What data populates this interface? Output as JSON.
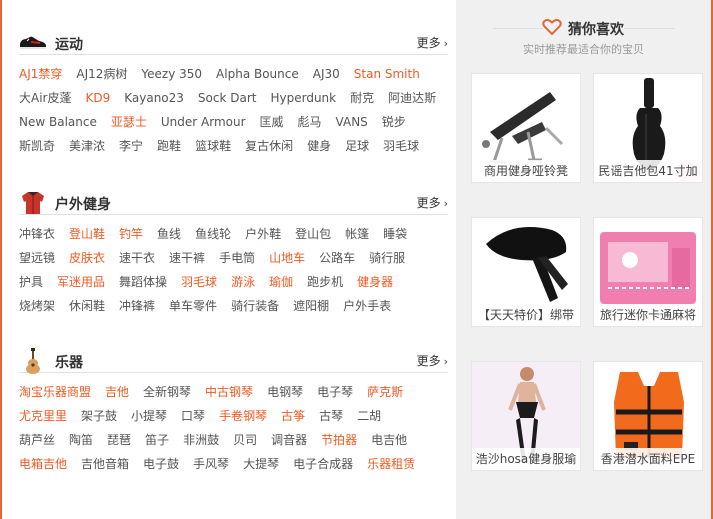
{
  "sections": [
    {
      "title": "运动",
      "more": "更多",
      "icon": "sneaker-icon",
      "rows": [
        [
          {
            "text": "AJ1禁穿",
            "hot": true
          },
          {
            "text": "AJ12病树",
            "hot": false
          },
          {
            "text": "Yeezy 350",
            "hot": false
          },
          {
            "text": "Alpha Bounce",
            "hot": false
          },
          {
            "text": "AJ30",
            "hot": false
          },
          {
            "text": "Stan Smith",
            "hot": true
          }
        ],
        [
          {
            "text": "大Air皮蓬",
            "hot": false
          },
          {
            "text": "KD9",
            "hot": true
          },
          {
            "text": "Kayano23",
            "hot": false
          },
          {
            "text": "Sock Dart",
            "hot": false
          },
          {
            "text": "Hyperdunk",
            "hot": false
          },
          {
            "text": "耐克",
            "hot": false
          },
          {
            "text": "阿迪达斯",
            "hot": false
          }
        ],
        [
          {
            "text": "New Balance",
            "hot": false
          },
          {
            "text": "亚瑟士",
            "hot": true
          },
          {
            "text": "Under Armour",
            "hot": false
          },
          {
            "text": "匡威",
            "hot": false
          },
          {
            "text": "彪马",
            "hot": false
          },
          {
            "text": "VANS",
            "hot": false
          },
          {
            "text": "锐步",
            "hot": false
          }
        ],
        [
          {
            "text": "斯凯奇",
            "hot": false
          },
          {
            "text": "美津浓",
            "hot": false
          },
          {
            "text": "李宁",
            "hot": false
          },
          {
            "text": "跑鞋",
            "hot": false
          },
          {
            "text": "篮球鞋",
            "hot": false
          },
          {
            "text": "复古休闲",
            "hot": false
          },
          {
            "text": "健身",
            "hot": false
          },
          {
            "text": "足球",
            "hot": false
          },
          {
            "text": "羽毛球",
            "hot": false
          }
        ]
      ]
    },
    {
      "title": "户外健身",
      "more": "更多",
      "icon": "outdoor-jacket-icon",
      "rows": [
        [
          {
            "text": "冲锋衣",
            "hot": false
          },
          {
            "text": "登山鞋",
            "hot": true
          },
          {
            "text": "钓竿",
            "hot": true
          },
          {
            "text": "鱼线",
            "hot": false
          },
          {
            "text": "鱼线轮",
            "hot": false
          },
          {
            "text": "户外鞋",
            "hot": false
          },
          {
            "text": "登山包",
            "hot": false
          },
          {
            "text": "帐篷",
            "hot": false
          },
          {
            "text": "睡袋",
            "hot": false
          }
        ],
        [
          {
            "text": "望远镜",
            "hot": false
          },
          {
            "text": "皮肤衣",
            "hot": true
          },
          {
            "text": "速干衣",
            "hot": false
          },
          {
            "text": "速干裤",
            "hot": false
          },
          {
            "text": "手电筒",
            "hot": false
          },
          {
            "text": "山地车",
            "hot": true
          },
          {
            "text": "公路车",
            "hot": false
          },
          {
            "text": "骑行服",
            "hot": false
          }
        ],
        [
          {
            "text": "护具",
            "hot": false
          },
          {
            "text": "军迷用品",
            "hot": true
          },
          {
            "text": "舞蹈体操",
            "hot": false
          },
          {
            "text": "羽毛球",
            "hot": true
          },
          {
            "text": "游泳",
            "hot": true
          },
          {
            "text": "瑜伽",
            "hot": true
          },
          {
            "text": "跑步机",
            "hot": false
          },
          {
            "text": "健身器",
            "hot": true
          }
        ],
        [
          {
            "text": "烧烤架",
            "hot": false
          },
          {
            "text": "休闲鞋",
            "hot": false
          },
          {
            "text": "冲锋裤",
            "hot": false
          },
          {
            "text": "单车零件",
            "hot": false
          },
          {
            "text": "骑行装备",
            "hot": false
          },
          {
            "text": "遮阳棚",
            "hot": false
          },
          {
            "text": "户外手表",
            "hot": false
          }
        ]
      ]
    },
    {
      "title": "乐器",
      "more": "更多",
      "icon": "guitar-icon",
      "rows": [
        [
          {
            "text": "淘宝乐器商盟",
            "hot": true
          },
          {
            "text": "吉他",
            "hot": true
          },
          {
            "text": "全新钢琴",
            "hot": false
          },
          {
            "text": "中古钢琴",
            "hot": true
          },
          {
            "text": "电钢琴",
            "hot": false
          },
          {
            "text": "电子琴",
            "hot": false
          },
          {
            "text": "萨克斯",
            "hot": true
          }
        ],
        [
          {
            "text": "尤克里里",
            "hot": true
          },
          {
            "text": "架子鼓",
            "hot": false
          },
          {
            "text": "小提琴",
            "hot": false
          },
          {
            "text": "口琴",
            "hot": false
          },
          {
            "text": "手卷钢琴",
            "hot": true
          },
          {
            "text": "古筝",
            "hot": true
          },
          {
            "text": "古琴",
            "hot": false
          },
          {
            "text": "二胡",
            "hot": false
          }
        ],
        [
          {
            "text": "葫芦丝",
            "hot": false
          },
          {
            "text": "陶笛",
            "hot": false
          },
          {
            "text": "琵琶",
            "hot": false
          },
          {
            "text": "笛子",
            "hot": false
          },
          {
            "text": "非洲鼓",
            "hot": false
          },
          {
            "text": "贝司",
            "hot": false
          },
          {
            "text": "调音器",
            "hot": false
          },
          {
            "text": "节拍器",
            "hot": true
          },
          {
            "text": "电吉他",
            "hot": false
          }
        ],
        [
          {
            "text": "电箱吉他",
            "hot": true
          },
          {
            "text": "吉他音箱",
            "hot": false
          },
          {
            "text": "电子鼓",
            "hot": false
          },
          {
            "text": "手风琴",
            "hot": false
          },
          {
            "text": "大提琴",
            "hot": false
          },
          {
            "text": "电子合成器",
            "hot": false
          },
          {
            "text": "乐器租赁",
            "hot": true
          }
        ]
      ]
    }
  ],
  "guess": {
    "title": "猜你喜欢",
    "subtitle": "实时推荐最适合你的宝贝",
    "items": [
      {
        "caption": "商用健身哑铃凳",
        "image": "weight-bench-image"
      },
      {
        "caption": "民谣吉他包41寸加",
        "image": "guitar-bag-image"
      },
      {
        "caption": "【天天特价】绑带",
        "image": "headband-image"
      },
      {
        "caption": "旅行迷你卡通麻将",
        "image": "mahjong-set-image"
      },
      {
        "caption": "浩沙hosa健身服瑜",
        "image": "yoga-outfit-image"
      },
      {
        "caption": "香港潜水面料EPE",
        "image": "life-vest-image"
      }
    ]
  },
  "colors": {
    "accent": "#f05a22",
    "frame": "#e4663a",
    "sidebar_bg": "#f0f0f0"
  }
}
